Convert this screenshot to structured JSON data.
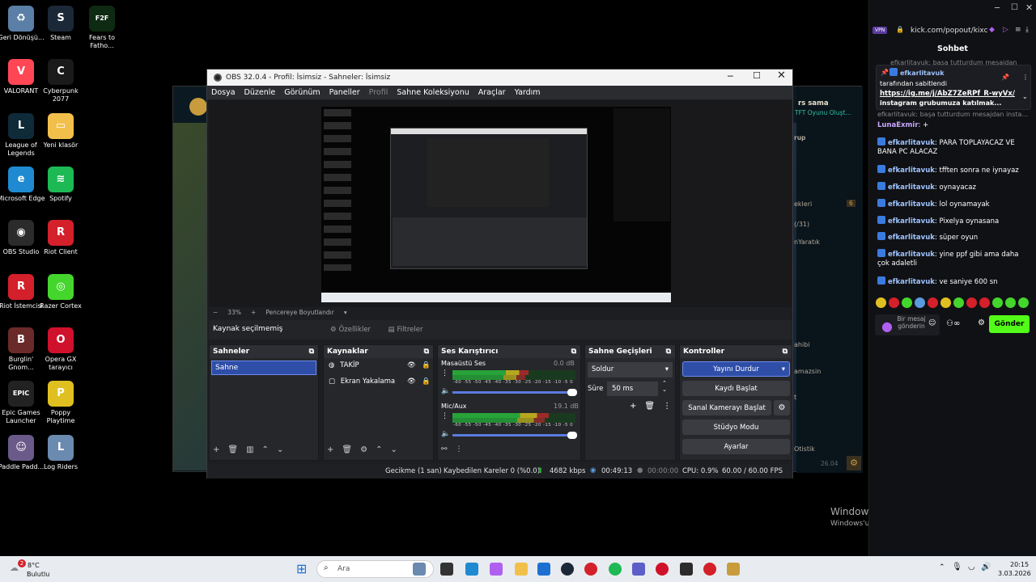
{
  "desktop": {
    "icons": [
      {
        "label": "Geri Dönüşü...",
        "color": "#5b7fa6",
        "glyph": "♻"
      },
      {
        "label": "Steam",
        "color": "#1b2838",
        "glyph": "S"
      },
      {
        "label": "Fears to Fatho...",
        "color": "#0e2a12",
        "glyph": "F2F"
      },
      {
        "label": "VALORANT",
        "color": "#ff4655",
        "glyph": "V"
      },
      {
        "label": "Cyberpunk 2077",
        "color": "#1a1a1a",
        "glyph": "C"
      },
      {
        "label": "League of Legends",
        "color": "#0f2a38",
        "glyph": "L"
      },
      {
        "label": "Yeni klasör",
        "color": "#f2c04a",
        "glyph": "▭"
      },
      {
        "label": "Microsoft Edge",
        "color": "#1f8ad1",
        "glyph": "e"
      },
      {
        "label": "Spotify",
        "color": "#1db954",
        "glyph": "≋"
      },
      {
        "label": "OBS Studio",
        "color": "#2b2b2b",
        "glyph": "◉"
      },
      {
        "label": "Riot Client",
        "color": "#d4202a",
        "glyph": "R"
      },
      {
        "label": "Riot İstemcisi",
        "color": "#d4202a",
        "glyph": "R"
      },
      {
        "label": "Razer Cortex",
        "color": "#44d62c",
        "glyph": "◎"
      },
      {
        "label": "Burglin' Gnom...",
        "color": "#6b2a2a",
        "glyph": "B"
      },
      {
        "label": "Opera GX tarayıcı",
        "color": "#d0112b",
        "glyph": "O"
      },
      {
        "label": "Epic Games Launcher",
        "color": "#222",
        "glyph": "EPIC"
      },
      {
        "label": "Poppy Playtime",
        "color": "#e0c020",
        "glyph": "P"
      },
      {
        "label": "Paddle Padd...",
        "color": "#6a5a8a",
        "glyph": "☺"
      },
      {
        "label": "Log Riders",
        "color": "#6a8ab0",
        "glyph": "L"
      }
    ],
    "watermark_title": "Windows'u Etkinleştir",
    "watermark_sub": "Windows'u etkinleştirmek için Ayarlar'a gidin."
  },
  "obs": {
    "title": "OBS 32.0.4 - Profil: İsimsiz - Sahneler: İsimsiz",
    "menu": [
      "Dosya",
      "Düzenle",
      "Görünüm",
      "Paneller",
      "Profil",
      "Sahne Koleksiyonu",
      "Araçlar",
      "Yardım"
    ],
    "zoom": "33%",
    "zoom_plus": "+",
    "zoom_minus": "−",
    "fit_label": "Pencereye Boyutlandır",
    "no_source": "Kaynak seçilmemiş",
    "properties": "Özellikler",
    "filters": "Filtreler",
    "panels": {
      "scenes": {
        "title": "Sahneler",
        "items": [
          "Sahne"
        ]
      },
      "sources": {
        "title": "Kaynaklar",
        "items": [
          "TAKİP",
          "Ekran Yakalama"
        ]
      },
      "mixer": {
        "title": "Ses Karıştırıcı",
        "channels": [
          {
            "name": "Masaüstü Ses",
            "db": "0.0 dB",
            "level": 0.62
          },
          {
            "name": "Mic/Aux",
            "db": "19.1 dB",
            "level": 0.78
          }
        ],
        "ticks": "-60 -55 -50 -45 -40 -35 -30 -25 -20 -15 -10 -5 0"
      },
      "transitions": {
        "title": "Sahne Geçişleri",
        "type": "Soldur",
        "duration_label": "Süre",
        "duration": "50 ms"
      },
      "controls": {
        "title": "Kontroller",
        "stream": "Yayını Durdur",
        "record": "Kaydı Başlat",
        "vcam": "Sanal Kamerayı Başlat",
        "studio": "Stüdyo Modu",
        "settings": "Ayarlar"
      }
    },
    "status": {
      "delay": "Gecikme (1 san)",
      "dropped": "Kaybedilen Kareler 0 (%0.0)",
      "bitrate": "4682 kbps",
      "stream_time": "00:49:13",
      "rec_time": "00:00:00",
      "cpu": "CPU: 0.9%",
      "fps": "60.00 / 60.00 FPS"
    }
  },
  "background_lol": {
    "username": "rs sama",
    "subtitle": "TFT Oyunu Oluşt...",
    "group": "rup",
    "friends": "ekleri",
    "friends_count": "6",
    "line1": "(/31)",
    "line2": "nYaratık",
    "line3": "ahibi",
    "line4": "amazsin",
    "line5": "t",
    "line6": "Otistik",
    "bottom_val": "26.04"
  },
  "kick": {
    "url": "kick.com/popout/kixc",
    "vpn": "VPN",
    "title": "Sohbet",
    "pinned_user": "efkarlitavuk",
    "pinned_by": "tarafından sabitlendi",
    "pinned_link": "https://ig.me/j/AbZ7ZeRPf_R-wyVx/",
    "pinned_text": "instagram grubumuza katılmak...",
    "partial_top": "efkarlitavuk: başa tutturdum mesajdan",
    "partial_2": "efkarlitavuk: başa tutturdum mesajdan insta...",
    "messages": [
      {
        "user": "LunaExmir",
        "text": "+"
      },
      {
        "user": "efkarlitavuk",
        "text": "PARA TOPLAYACAZ VE BANA PC ALACAZ"
      },
      {
        "user": "efkarlitavuk",
        "text": "tfften sonra ne iynayaz"
      },
      {
        "user": "efkarlitavuk",
        "text": "oynayacaz"
      },
      {
        "user": "efkarlitavuk",
        "text": "lol oynamayak"
      },
      {
        "user": "efkarlitavuk",
        "text": "Pixelya oynasana"
      },
      {
        "user": "efkarlitavuk",
        "text": "süper oyun"
      },
      {
        "user": "efkarlitavuk",
        "text": "yine ppf gibi ama daha çok adaletli"
      },
      {
        "user": "efkarlitavuk",
        "text": "ve saniye 600 sn"
      }
    ],
    "input_placeholder": "Bir mesaj gönderin",
    "send": "Gönder",
    "emotes": [
      "#e0c020",
      "#d4202a",
      "#44d62c",
      "#5b9be0",
      "#d4202a",
      "#e0c020",
      "#44d62c",
      "#d4202a",
      "#d4202a",
      "#44d62c",
      "#44d62c",
      "#44d62c"
    ]
  },
  "taskbar": {
    "weather_temp": "8°C",
    "weather_desc": "Bulutlu",
    "weather_badge": "2",
    "search": "Ara",
    "time": "20:15",
    "date": "3.03.2026"
  }
}
